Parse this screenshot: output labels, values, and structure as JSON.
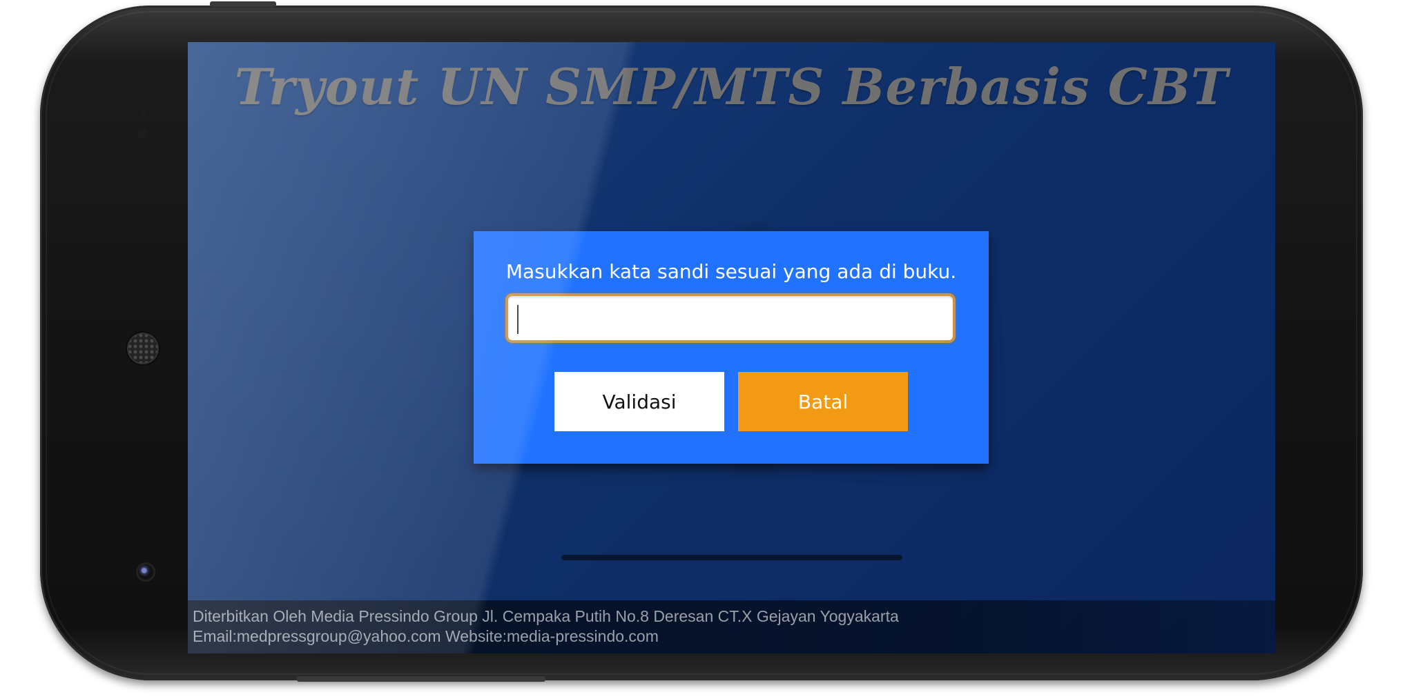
{
  "app": {
    "title": "Tryout UN SMP/MTS Berbasis CBT"
  },
  "dialog": {
    "message": "Masukkan kata sandi sesuai yang ada di buku.",
    "password_value": "",
    "validate_label": "Validasi",
    "cancel_label": "Batal"
  },
  "footer": {
    "line1": "Diterbitkan Oleh Media Pressindo Group Jl. Cempaka Putih No.8 Deresan CT.X Gejayan Yogyakarta",
    "line2": "Email:medpressgroup@yahoo.com Website:media-pressindo.com"
  },
  "colors": {
    "dialog_bg": "#2173ff",
    "cancel_button": "#f39a14",
    "screen_bg": "#0f2f68"
  }
}
